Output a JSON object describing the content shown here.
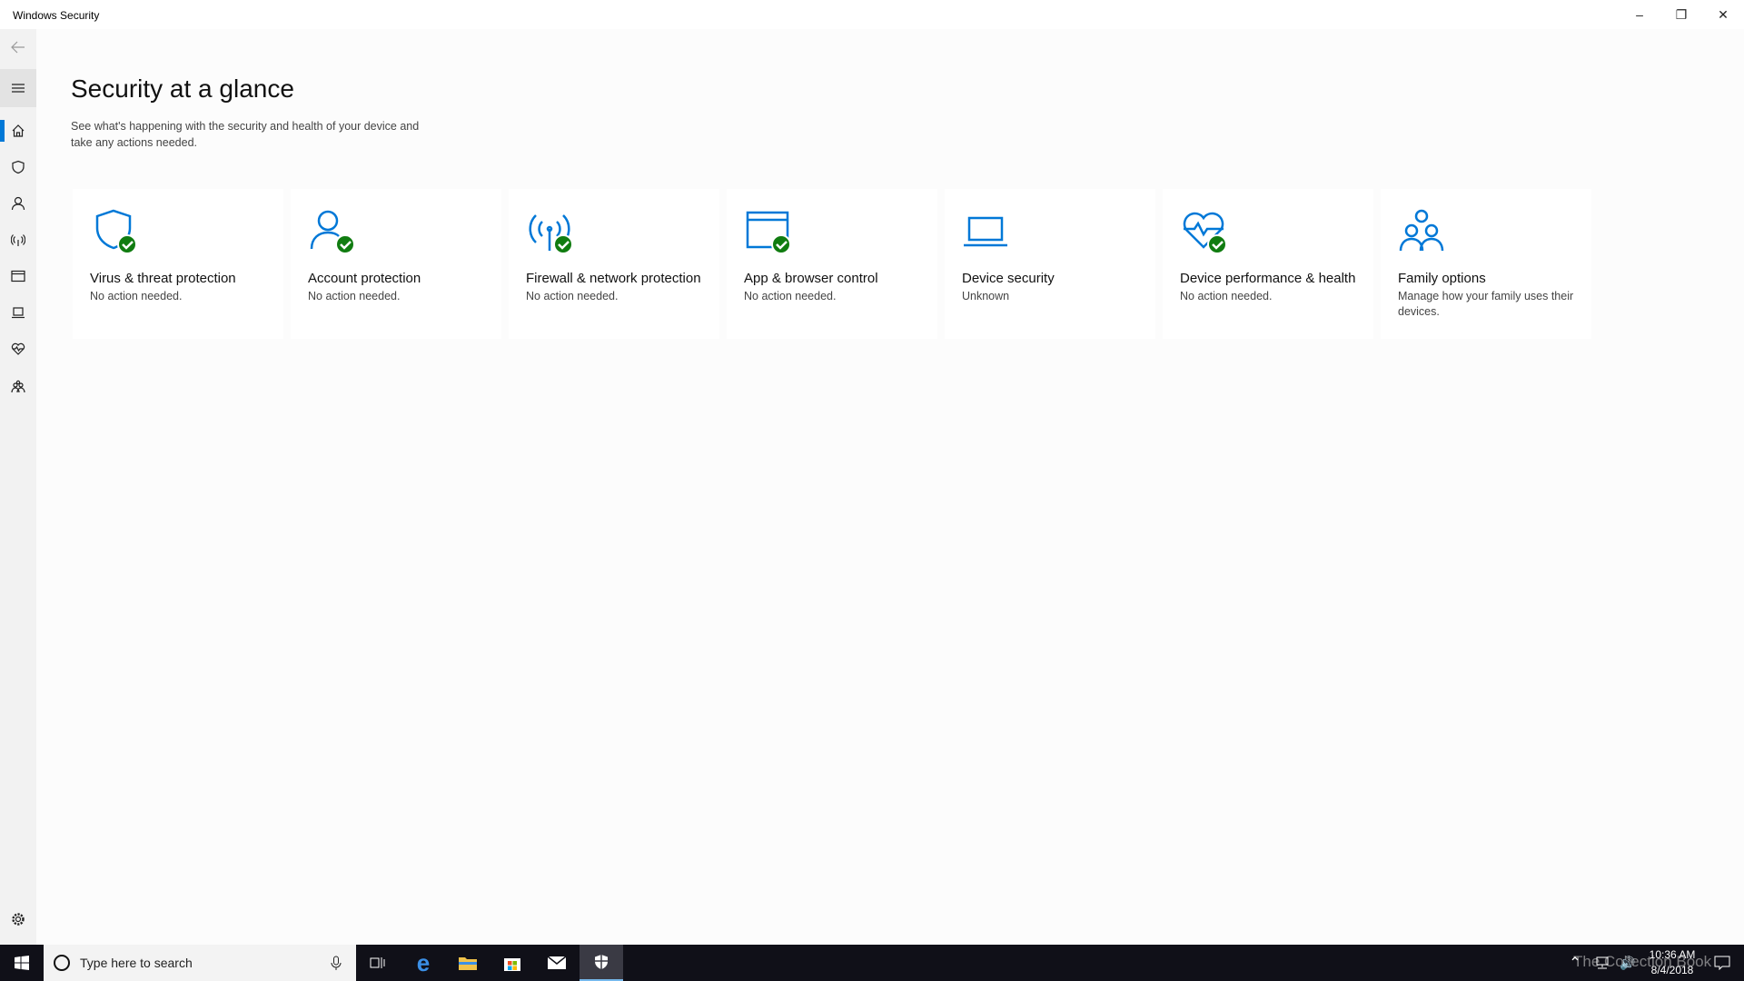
{
  "window": {
    "title": "Windows Security",
    "controls": [
      "minimize",
      "restore",
      "close"
    ]
  },
  "sidebar": {
    "items": [
      {
        "name": "back",
        "icon": "back-arrow-icon"
      },
      {
        "name": "menu",
        "icon": "hamburger-icon"
      },
      {
        "name": "home",
        "icon": "home-icon",
        "active": true
      },
      {
        "name": "virus",
        "icon": "shield-icon"
      },
      {
        "name": "account",
        "icon": "person-icon"
      },
      {
        "name": "firewall",
        "icon": "antenna-icon"
      },
      {
        "name": "app-browser",
        "icon": "browser-window-icon"
      },
      {
        "name": "device-security",
        "icon": "laptop-icon"
      },
      {
        "name": "device-health",
        "icon": "heart-icon"
      },
      {
        "name": "family",
        "icon": "family-icon"
      },
      {
        "name": "settings",
        "icon": "gear-icon"
      }
    ]
  },
  "main": {
    "title": "Security at a glance",
    "subtitle": "See what's happening with the security and health of your device and take any actions needed."
  },
  "cards": [
    {
      "label": "Virus & threat protection",
      "status": "No action needed.",
      "icon": "shield-icon",
      "ok": true
    },
    {
      "label": "Account protection",
      "status": "No action needed.",
      "icon": "person-icon",
      "ok": true
    },
    {
      "label": "Firewall & network protection",
      "status": "No action needed.",
      "icon": "antenna-icon",
      "ok": true
    },
    {
      "label": "App & browser control",
      "status": "No action needed.",
      "icon": "browser-window-icon",
      "ok": true
    },
    {
      "label": "Device security",
      "status": "Unknown",
      "icon": "laptop-icon",
      "ok": false
    },
    {
      "label": "Device performance & health",
      "status": "No action needed.",
      "icon": "heart-icon",
      "ok": true
    },
    {
      "label": "Family options",
      "status": "Manage how your family uses their devices.",
      "icon": "family-icon",
      "ok": false
    }
  ],
  "colors": {
    "accent": "#0078d7",
    "ok": "#107c10"
  },
  "taskbar": {
    "search_placeholder": "Type here to search",
    "time": "10:36 AM",
    "date": "8/4/2018",
    "watermark": "The Collection Book"
  }
}
